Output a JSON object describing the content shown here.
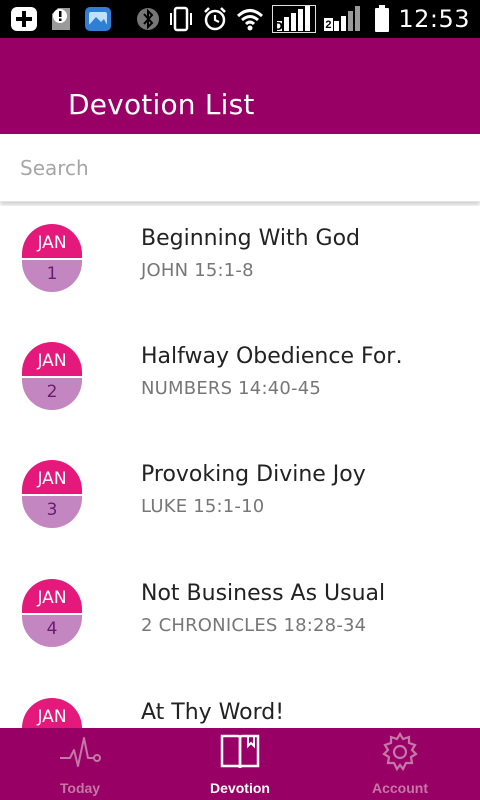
{
  "status_bar": {
    "time": "12:53",
    "icons": [
      "add-icon",
      "alert-sim-icon",
      "image-icon",
      "bluetooth-icon",
      "vibrate-icon",
      "alarm-icon",
      "wifi-icon",
      "signal-icon",
      "signal-2-icon",
      "battery-icon"
    ],
    "sim2_label": "2"
  },
  "header": {
    "title": "Devotion List"
  },
  "search": {
    "placeholder": "Search",
    "value": ""
  },
  "devotions": [
    {
      "month": "JAN",
      "day": "1",
      "title": "Beginning With God",
      "reference": "JOHN 15:1-8"
    },
    {
      "month": "JAN",
      "day": "2",
      "title": "Halfway Obedience For…",
      "reference": "NUMBERS 14:40-45"
    },
    {
      "month": "JAN",
      "day": "3",
      "title": "Provoking Divine Joy",
      "reference": "LUKE 15:1-10"
    },
    {
      "month": "JAN",
      "day": "4",
      "title": "Not Business As Usual",
      "reference": "2 CHRONICLES 18:28-34"
    },
    {
      "month": "JAN",
      "day": "",
      "title": "At Thy Word!",
      "reference": ""
    }
  ],
  "bottom_nav": {
    "items": [
      {
        "label": "Today",
        "icon": "heartbeat-icon",
        "active": false
      },
      {
        "label": "Devotion",
        "icon": "book-icon",
        "active": true
      },
      {
        "label": "Account",
        "icon": "gear-icon",
        "active": false
      }
    ]
  },
  "colors": {
    "primary": "#990066",
    "badge_top": "#e5197c",
    "badge_bottom": "#c486c0",
    "inactive_nav": "#c478a6"
  }
}
